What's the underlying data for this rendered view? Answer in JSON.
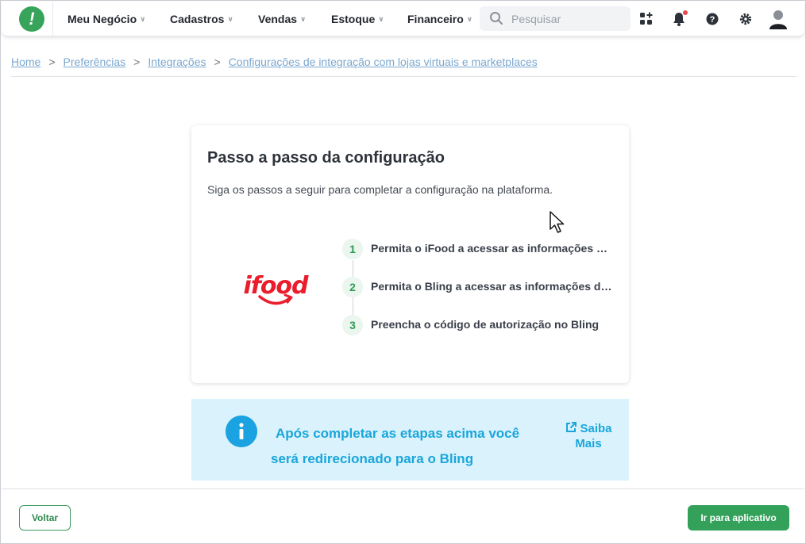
{
  "nav": {
    "items": [
      {
        "label": "Meu Negócio"
      },
      {
        "label": "Cadastros"
      },
      {
        "label": "Vendas"
      },
      {
        "label": "Estoque"
      },
      {
        "label": "Financeiro"
      }
    ],
    "search_placeholder": "Pesquisar",
    "icons": [
      "apps-icon",
      "bell-icon",
      "help-icon",
      "gear-icon",
      "avatar-icon"
    ],
    "notification_dot_color": "#e54b4b"
  },
  "breadcrumb": [
    "Home",
    "Preferências",
    "Integrações",
    "Configurações de integração com lojas virtuais e marketplaces"
  ],
  "card": {
    "title": "Passo a passo da configuração",
    "subtitle": "Siga os passos a seguir para completar a configuração na plataforma.",
    "logo_text": "ifood",
    "steps": [
      {
        "number": "1",
        "text": "Permita o iFood a acessar as informações do Bling"
      },
      {
        "number": "2",
        "text": "Permita o Bling a acessar as informações do iFood"
      },
      {
        "number": "3",
        "text": "Preencha o código de autorização no Bling"
      }
    ]
  },
  "info": {
    "line1": "Após completar as etapas acima você",
    "line2": "será redirecionado para o Bling",
    "link_line1": "Saiba",
    "link_line2": "Mais"
  },
  "footer": {
    "back_label": "Voltar",
    "go_label": "Ir para aplicativo"
  },
  "colors": {
    "brand_green": "#38a35a",
    "info_blue": "#1ba6dc",
    "ifood_red": "#ea1d2c"
  }
}
